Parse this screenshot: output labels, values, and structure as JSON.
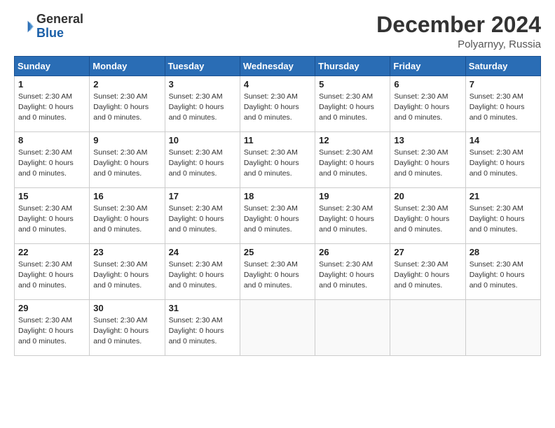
{
  "logo": {
    "general": "General",
    "blue": "Blue"
  },
  "title": "December 2024",
  "location": "Polyarnyy, Russia",
  "day_cell_info": "Sunset: 2:30 AM\nDaylight: 0 hours and 0 minutes.",
  "days_of_week": [
    "Sunday",
    "Monday",
    "Tuesday",
    "Wednesday",
    "Thursday",
    "Friday",
    "Saturday"
  ],
  "weeks": [
    [
      {
        "num": "1",
        "info": "Sunset: 2:30 AM\nDaylight: 0 hours\nand 0 minutes."
      },
      {
        "num": "2",
        "info": "Sunset: 2:30 AM\nDaylight: 0 hours\nand 0 minutes."
      },
      {
        "num": "3",
        "info": "Sunset: 2:30 AM\nDaylight: 0 hours\nand 0 minutes."
      },
      {
        "num": "4",
        "info": "Sunset: 2:30 AM\nDaylight: 0 hours\nand 0 minutes."
      },
      {
        "num": "5",
        "info": "Sunset: 2:30 AM\nDaylight: 0 hours\nand 0 minutes."
      },
      {
        "num": "6",
        "info": "Sunset: 2:30 AM\nDaylight: 0 hours\nand 0 minutes."
      },
      {
        "num": "7",
        "info": "Sunset: 2:30 AM\nDaylight: 0 hours\nand 0 minutes."
      }
    ],
    [
      {
        "num": "8",
        "info": "Sunset: 2:30 AM\nDaylight: 0 hours\nand 0 minutes."
      },
      {
        "num": "9",
        "info": "Sunset: 2:30 AM\nDaylight: 0 hours\nand 0 minutes."
      },
      {
        "num": "10",
        "info": "Sunset: 2:30 AM\nDaylight: 0 hours\nand 0 minutes."
      },
      {
        "num": "11",
        "info": "Sunset: 2:30 AM\nDaylight: 0 hours\nand 0 minutes."
      },
      {
        "num": "12",
        "info": "Sunset: 2:30 AM\nDaylight: 0 hours\nand 0 minutes."
      },
      {
        "num": "13",
        "info": "Sunset: 2:30 AM\nDaylight: 0 hours\nand 0 minutes."
      },
      {
        "num": "14",
        "info": "Sunset: 2:30 AM\nDaylight: 0 hours\nand 0 minutes."
      }
    ],
    [
      {
        "num": "15",
        "info": "Sunset: 2:30 AM\nDaylight: 0 hours\nand 0 minutes."
      },
      {
        "num": "16",
        "info": "Sunset: 2:30 AM\nDaylight: 0 hours\nand 0 minutes."
      },
      {
        "num": "17",
        "info": "Sunset: 2:30 AM\nDaylight: 0 hours\nand 0 minutes."
      },
      {
        "num": "18",
        "info": "Sunset: 2:30 AM\nDaylight: 0 hours\nand 0 minutes."
      },
      {
        "num": "19",
        "info": "Sunset: 2:30 AM\nDaylight: 0 hours\nand 0 minutes."
      },
      {
        "num": "20",
        "info": "Sunset: 2:30 AM\nDaylight: 0 hours\nand 0 minutes."
      },
      {
        "num": "21",
        "info": "Sunset: 2:30 AM\nDaylight: 0 hours\nand 0 minutes."
      }
    ],
    [
      {
        "num": "22",
        "info": "Sunset: 2:30 AM\nDaylight: 0 hours\nand 0 minutes."
      },
      {
        "num": "23",
        "info": "Sunset: 2:30 AM\nDaylight: 0 hours\nand 0 minutes."
      },
      {
        "num": "24",
        "info": "Sunset: 2:30 AM\nDaylight: 0 hours\nand 0 minutes."
      },
      {
        "num": "25",
        "info": "Sunset: 2:30 AM\nDaylight: 0 hours\nand 0 minutes."
      },
      {
        "num": "26",
        "info": "Sunset: 2:30 AM\nDaylight: 0 hours\nand 0 minutes."
      },
      {
        "num": "27",
        "info": "Sunset: 2:30 AM\nDaylight: 0 hours\nand 0 minutes."
      },
      {
        "num": "28",
        "info": "Sunset: 2:30 AM\nDaylight: 0 hours\nand 0 minutes."
      }
    ],
    [
      {
        "num": "29",
        "info": "Sunset: 2:30 AM\nDaylight: 0 hours\nand 0 minutes."
      },
      {
        "num": "30",
        "info": "Sunset: 2:30 AM\nDaylight: 0 hours\nand 0 minutes."
      },
      {
        "num": "31",
        "info": "Sunset: 2:30 AM\nDaylight: 0 hours\nand 0 minutes."
      },
      {
        "num": "",
        "info": ""
      },
      {
        "num": "",
        "info": ""
      },
      {
        "num": "",
        "info": ""
      },
      {
        "num": "",
        "info": ""
      }
    ]
  ]
}
